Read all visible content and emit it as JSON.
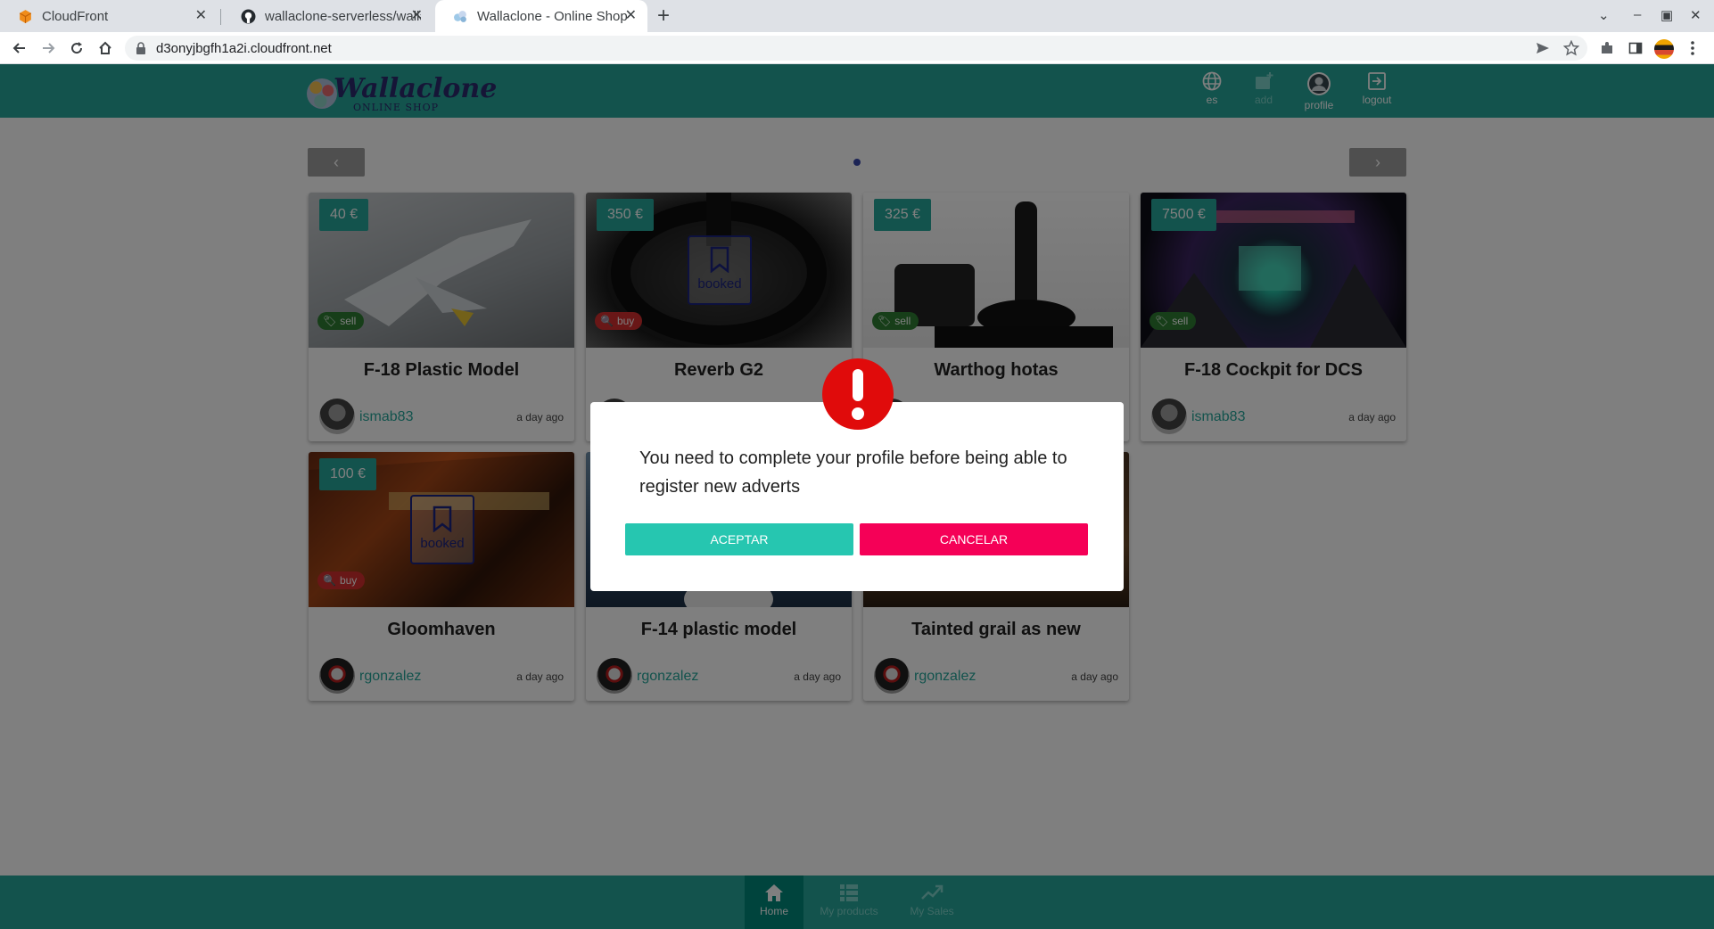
{
  "browser": {
    "tabs": [
      {
        "title": "CloudFront"
      },
      {
        "title": "wallaclone-serverless/wallaclone"
      },
      {
        "title": "Wallaclone - Online Shop"
      }
    ],
    "url": "d3onyjbgfh1a2i.cloudfront.net"
  },
  "header": {
    "logo_text": "Wallaclone",
    "logo_sub": "ONLINE SHOP",
    "nav": {
      "lang": "es",
      "add": "add",
      "profile": "profile",
      "logout": "logout"
    }
  },
  "products": [
    {
      "price": "40 €",
      "tag": "sell",
      "title": "F-18 Plastic Model",
      "user": "ismab83",
      "time": "a day ago",
      "booked": false
    },
    {
      "price": "350 €",
      "tag": "buy",
      "title": "Reverb G2",
      "user": "",
      "time": "",
      "booked": true,
      "booked_label": "booked"
    },
    {
      "price": "325 €",
      "tag": "sell",
      "title": "Warthog hotas",
      "user": "",
      "time": "",
      "booked": false
    },
    {
      "price": "7500 €",
      "tag": "sell",
      "title": "F-18 Cockpit for DCS",
      "user": "ismab83",
      "time": "a day ago",
      "booked": false
    },
    {
      "price": "100 €",
      "tag": "buy",
      "title": "Gloomhaven",
      "user": "rgonzalez",
      "time": "a day ago",
      "booked": true,
      "booked_label": "booked"
    },
    {
      "title": "F-14 plastic model",
      "user": "rgonzalez",
      "time": "a day ago"
    },
    {
      "title": "Tainted grail as new",
      "user": "rgonzalez",
      "time": "a day ago"
    }
  ],
  "footer": {
    "home": "Home",
    "my_products": "My products",
    "my_sales": "My Sales"
  },
  "dialog": {
    "message": "You need to complete your profile before being able to register new adverts",
    "accept": "ACEPTAR",
    "cancel": "CANCELAR"
  },
  "colors": {
    "brand": "#26a69a",
    "accept": "#26c6b0",
    "cancel": "#f50057",
    "alert": "#e00b0b"
  }
}
